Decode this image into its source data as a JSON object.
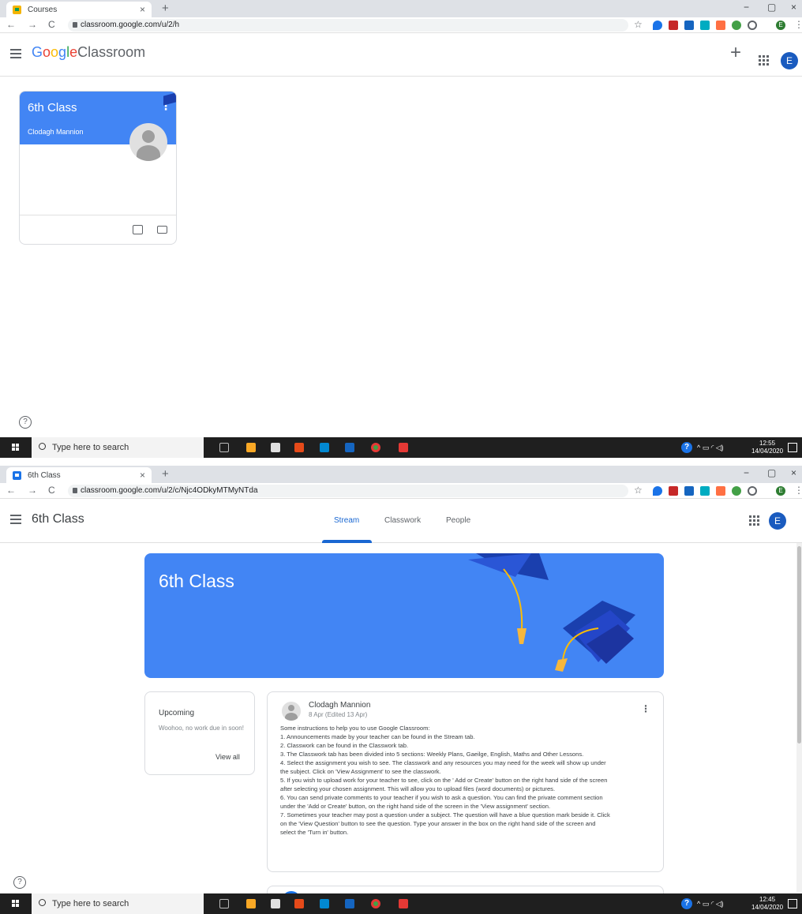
{
  "screen1": {
    "tab": {
      "title": "Courses",
      "close": "×",
      "new_tab": "+"
    },
    "window_controls": {
      "minimize": "−",
      "maximize": "▢",
      "close": "×"
    },
    "url": "classroom.google.com/u/2/h",
    "nav": {
      "back": "←",
      "forward": "→",
      "reload": "C"
    },
    "star": "☆",
    "profile_letter": "E",
    "brand": {
      "g1": "G",
      "o1": "o",
      "o2": "o",
      "g2": "g",
      "l": "l",
      "e": "e",
      "rest": "Classroom"
    },
    "add_label": "+",
    "account_letter": "E",
    "card": {
      "title": "6th Class",
      "teacher": "Clodagh Mannion",
      "menu": "⋮"
    },
    "help": "?"
  },
  "taskbar1": {
    "search_placeholder": "Type here to search",
    "time": "12:55",
    "date": "14/04/2020",
    "tray": "^ ▭ ◜ ◁)",
    "notifications": "3"
  },
  "screen2": {
    "tab": {
      "title": "6th Class",
      "close": "×",
      "new_tab": "+"
    },
    "window_controls": {
      "minimize": "−",
      "maximize": "▢",
      "close": "×"
    },
    "url": "classroom.google.com/u/2/c/Njc4ODkyMTMyNTda",
    "nav": {
      "back": "←",
      "forward": "→",
      "reload": "C"
    },
    "star": "☆",
    "profile_letter": "E",
    "class_name": "6th Class",
    "tabs": [
      {
        "label": "Stream"
      },
      {
        "label": "Classwork"
      },
      {
        "label": "People"
      }
    ],
    "account_letter": "E",
    "banner_title": "6th Class",
    "upcoming": {
      "title": "Upcoming",
      "message": "Woohoo, no work due in soon!",
      "link": "View all"
    },
    "post": {
      "author": "Clodagh Mannion",
      "date": "8 Apr (Edited 13 Apr)",
      "menu": "⋮",
      "lines": [
        "Some instructions to help you to use Google Classroom:",
        "1. Announcements made by your teacher can be found in the Stream tab.",
        "2. Classwork can be found in the Classwork tab.",
        "3. The Classwork tab has been divided into 5 sections: Weekly Plans, Gaeilge, English, Maths and Other Lessons.",
        "4. Select the assignment you wish to see. The classwork and any resources you may need for the week will show up under",
        "the subject. Click on 'View Assignment' to see the classwork.",
        "5. If you wish to upload work for your teacher to see, click on the ' Add or Create' button on the right hand side of the screen",
        "after selecting your chosen assignment. This will allow you to upload files (word documents) or pictures.",
        "6. You can send private comments to your teacher if you wish to ask a question. You can find the private comment section",
        "under the 'Add or Create' button, on the right hand side of the screen in the 'View assignment' section.",
        "7. Sometimes your teacher may post a question under a subject. The question will have a blue question mark beside it. Click",
        "on the 'View Question' button to see the question. Type your answer in the box on the right hand side of the screen and",
        "select the 'Turn in' button."
      ]
    },
    "help": "?"
  },
  "taskbar2": {
    "search_placeholder": "Type here to search",
    "time": "12:45",
    "date": "14/04/2020",
    "tray": "^ ▭ ◜ ◁)",
    "notifications": "3"
  },
  "colors": {
    "classroom_blue": "#4285f4",
    "active_tab": "#1967d2",
    "avatar": "#1a5bbf",
    "taskbar": "#1f1f1f"
  }
}
